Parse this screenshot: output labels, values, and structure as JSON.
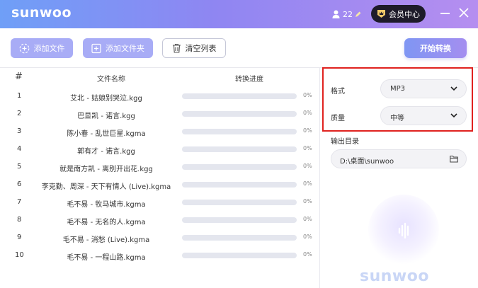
{
  "app": {
    "logo": "sunwoo",
    "user_count": "22",
    "vip_label": "会员中心"
  },
  "toolbar": {
    "add_file": "添加文件",
    "add_folder": "添加文件夹",
    "clear_list": "清空列表",
    "start": "开始转换"
  },
  "table": {
    "headers": {
      "num": "#",
      "name": "文件名称",
      "progress": "转换进度"
    },
    "rows": [
      {
        "num": "1",
        "name": "艾北 - 姑娘别哭泣.kgg",
        "progress_pct": "0%",
        "progress": 0
      },
      {
        "num": "2",
        "name": "巴显凯 - 诺言.kgg",
        "progress_pct": "0%",
        "progress": 0
      },
      {
        "num": "3",
        "name": "陈小春 - 乱世巨星.kgma",
        "progress_pct": "0%",
        "progress": 0
      },
      {
        "num": "4",
        "name": "郭有才 - 诺言.kgg",
        "progress_pct": "0%",
        "progress": 0
      },
      {
        "num": "5",
        "name": "就是南方凯 - 离别开出花.kgg",
        "progress_pct": "0%",
        "progress": 0
      },
      {
        "num": "6",
        "name": "李克勤、周深 - 天下有情人 (Live).kgma",
        "progress_pct": "0%",
        "progress": 0
      },
      {
        "num": "7",
        "name": "毛不易 - 牧马城市.kgma",
        "progress_pct": "0%",
        "progress": 0
      },
      {
        "num": "8",
        "name": "毛不易 - 无名的人.kgma",
        "progress_pct": "0%",
        "progress": 0
      },
      {
        "num": "9",
        "name": "毛不易 - 消愁 (Live).kgma",
        "progress_pct": "0%",
        "progress": 0
      },
      {
        "num": "10",
        "name": "毛不易 - 一程山路.kgma",
        "progress_pct": "0%",
        "progress": 0
      }
    ]
  },
  "settings": {
    "format_label": "格式",
    "format_value": "MP3",
    "quality_label": "质量",
    "quality_value": "中等",
    "output_label": "输出目录",
    "output_value": "D:\\桌面\\sunwoo"
  },
  "watermark": {
    "text": "sunwoo"
  },
  "colors": {
    "accent": "#a8acf6",
    "highlight_border": "#e0221f",
    "vip_bg": "#1e1b2a"
  }
}
